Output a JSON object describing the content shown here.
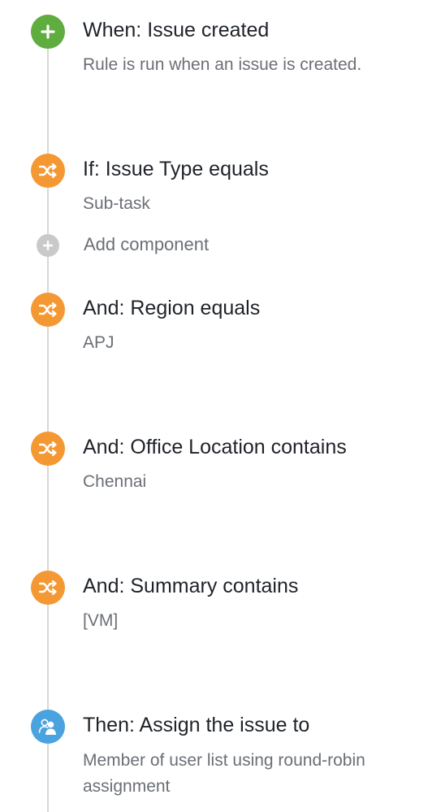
{
  "rule": {
    "components": [
      {
        "kind": "trigger",
        "title": "When: Issue created",
        "desc": "Rule is run when an issue is created.",
        "icon": "plus-icon"
      },
      {
        "kind": "condition",
        "title": "If: Issue Type equals",
        "desc": "Sub-task",
        "icon": "shuffle-icon"
      },
      {
        "kind": "add",
        "label": "Add component",
        "icon": "plus-icon"
      },
      {
        "kind": "condition",
        "title": "And: Region equals",
        "desc": "APJ",
        "icon": "shuffle-icon"
      },
      {
        "kind": "condition",
        "title": "And: Office Location contains",
        "desc": "Chennai",
        "icon": "shuffle-icon"
      },
      {
        "kind": "condition",
        "title": "And: Summary contains",
        "desc": "[VM]",
        "icon": "shuffle-icon"
      },
      {
        "kind": "action",
        "title": "Then: Assign the issue to",
        "desc": "Member of user list using round-robin assignment",
        "icon": "users-icon"
      }
    ]
  },
  "colors": {
    "trigger": "#5fac3f",
    "condition": "#f49833",
    "action": "#4aa3df",
    "add": "#c9c9c9",
    "timeline": "#d7d7d7"
  }
}
